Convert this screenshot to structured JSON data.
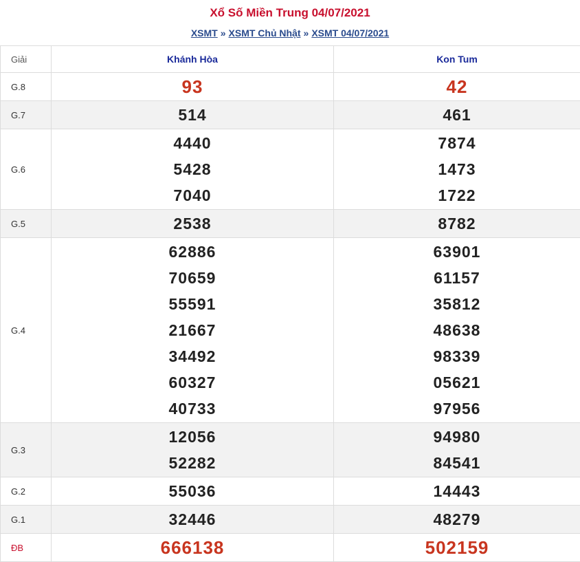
{
  "header": {
    "title": "Xổ Số Miền Trung 04/07/2021",
    "breadcrumb": [
      "XSMT",
      "XSMT Chủ Nhật",
      "XSMT 04/07/2021"
    ],
    "separator": "»"
  },
  "table": {
    "col_prize": "Giải",
    "provinces": [
      "Khánh Hòa",
      "Kon Tum"
    ],
    "rows": [
      {
        "prize": "G.8",
        "a": [
          "93"
        ],
        "b": [
          "42"
        ]
      },
      {
        "prize": "G.7",
        "a": [
          "514"
        ],
        "b": [
          "461"
        ]
      },
      {
        "prize": "G.6",
        "a": [
          "4440",
          "5428",
          "7040"
        ],
        "b": [
          "7874",
          "1473",
          "1722"
        ]
      },
      {
        "prize": "G.5",
        "a": [
          "2538"
        ],
        "b": [
          "8782"
        ]
      },
      {
        "prize": "G.4",
        "a": [
          "62886",
          "70659",
          "55591",
          "21667",
          "34492",
          "60327",
          "40733"
        ],
        "b": [
          "63901",
          "61157",
          "35812",
          "48638",
          "98339",
          "05621",
          "97956"
        ]
      },
      {
        "prize": "G.3",
        "a": [
          "12056",
          "52282"
        ],
        "b": [
          "94980",
          "84541"
        ]
      },
      {
        "prize": "G.2",
        "a": [
          "55036"
        ],
        "b": [
          "14443"
        ]
      },
      {
        "prize": "G.1",
        "a": [
          "32446"
        ],
        "b": [
          "48279"
        ]
      },
      {
        "prize": "ĐB",
        "a": [
          "666138"
        ],
        "b": [
          "502159"
        ]
      }
    ]
  },
  "colors": {
    "title": "#c8102e",
    "link": "#2a4b8d",
    "highlight": "#c8351f",
    "province": "#1a2a9a"
  }
}
